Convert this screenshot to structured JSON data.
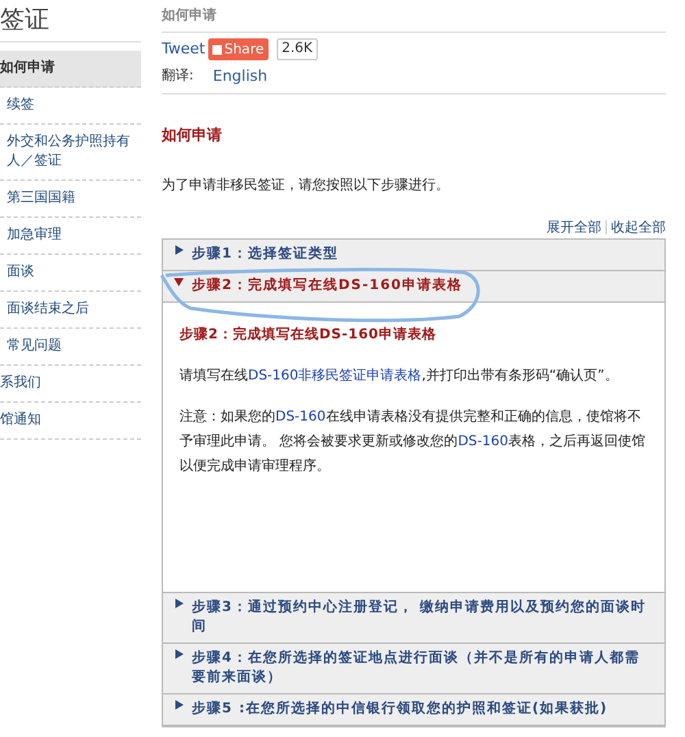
{
  "sidebar": {
    "title": "签证",
    "items": [
      {
        "label": "如何申请",
        "selected": true,
        "children": [
          {
            "label": "续签",
            "selected": false
          },
          {
            "label": "外交和公务护照持有人／签证",
            "selected": false
          },
          {
            "label": "第三国国籍",
            "selected": false
          },
          {
            "label": "加急审理",
            "selected": false
          },
          {
            "label": "面谈",
            "selected": false
          },
          {
            "label": "面谈结束之后",
            "selected": false
          },
          {
            "label": "常见问题",
            "selected": false
          }
        ]
      },
      {
        "label": "系我们",
        "selected": false
      },
      {
        "label": "馆通知",
        "selected": false
      }
    ]
  },
  "breadcrumb": "如何申请",
  "share": {
    "tweet": "Tweet",
    "share": "Share",
    "count": "2.6K"
  },
  "translate": {
    "label": "翻译:",
    "language": "English"
  },
  "heading": "如何申请",
  "intro": "为了申请非移民签证，请您按照以下步骤进行。",
  "controls": {
    "expand_all": "展开全部",
    "collapse_all": "收起全部"
  },
  "steps": [
    {
      "title": "步骤1：选择签证类型",
      "expanded": false
    },
    {
      "title": "步骤2：完成填写在线DS-160申请表格",
      "expanded": true,
      "content": {
        "heading": "步骤2：完成填写在线DS-160申请表格",
        "paragraphs": [
          [
            {
              "kind": "text",
              "text": "请填写在线"
            },
            {
              "kind": "link",
              "text": "DS-160非移民签证申请表格"
            },
            {
              "kind": "text",
              "text": ",并打印出带有条形码“确认页”。"
            }
          ],
          [
            {
              "kind": "text",
              "text": "注意：如果您的"
            },
            {
              "kind": "highlight",
              "text": "DS-160"
            },
            {
              "kind": "text",
              "text": "在线申请表格没有提供完整和正确的信息，使馆将不予审理此申请。 您将会被要求更新或修改您的"
            },
            {
              "kind": "highlight",
              "text": "DS-160"
            },
            {
              "kind": "text",
              "text": "表格，之后再返回使馆以便完成申请审理程序。"
            }
          ]
        ]
      }
    },
    {
      "title": "步骤3：通过预约中心注册登记， 缴纳申请费用以及预约您的面谈时间",
      "expanded": false
    },
    {
      "title": "步骤4：在您所选择的签证地点进行面谈（并不是所有的申请人都需要前来面谈）",
      "expanded": false
    },
    {
      "title": "步骤5 :在您所选择的中信银行领取您的护照和签证(如果获批)",
      "expanded": false
    }
  ]
}
